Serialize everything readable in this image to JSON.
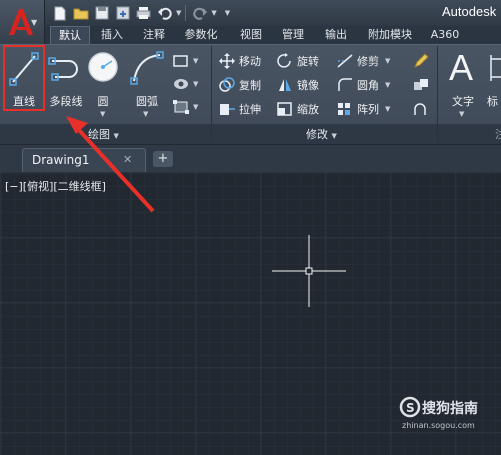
{
  "app": {
    "title": "Autodesk"
  },
  "ribbon_tabs": [
    "默认",
    "插入",
    "注释",
    "参数化",
    "视图",
    "管理",
    "输出",
    "附加模块",
    "A360"
  ],
  "draw_panel": {
    "title": "绘图",
    "tools": [
      {
        "label": "直线",
        "icon": "line-icon"
      },
      {
        "label": "多段线",
        "icon": "polyline-icon"
      },
      {
        "label": "圆",
        "icon": "circle-icon"
      },
      {
        "label": "圆弧",
        "icon": "arc-icon"
      }
    ]
  },
  "modify_panel": {
    "title": "修改",
    "tools": [
      {
        "label": "移动",
        "icon": "move-icon"
      },
      {
        "label": "旋转",
        "icon": "rotate-icon"
      },
      {
        "label": "修剪",
        "icon": "trim-icon"
      },
      {
        "label": "复制",
        "icon": "copy-icon"
      },
      {
        "label": "镜像",
        "icon": "mirror-icon"
      },
      {
        "label": "圆角",
        "icon": "fillet-icon"
      },
      {
        "label": "拉伸",
        "icon": "stretch-icon"
      },
      {
        "label": "缩放",
        "icon": "scale-icon"
      },
      {
        "label": "阵列",
        "icon": "array-icon"
      }
    ]
  },
  "annotation_panel": {
    "text_label": "文字",
    "partial_label": "标"
  },
  "document": {
    "tab_name": "Drawing1",
    "close_glyph": "✕",
    "new_tab_glyph": "+"
  },
  "viewport": {
    "label": "[−][俯视][二维线框]"
  },
  "watermark": {
    "text": "搜狗指南",
    "url": "zhinan.sogou.com"
  },
  "colors": {
    "highlight": "#e7302a",
    "canvas": "#212830",
    "logo": "#d8231f"
  }
}
